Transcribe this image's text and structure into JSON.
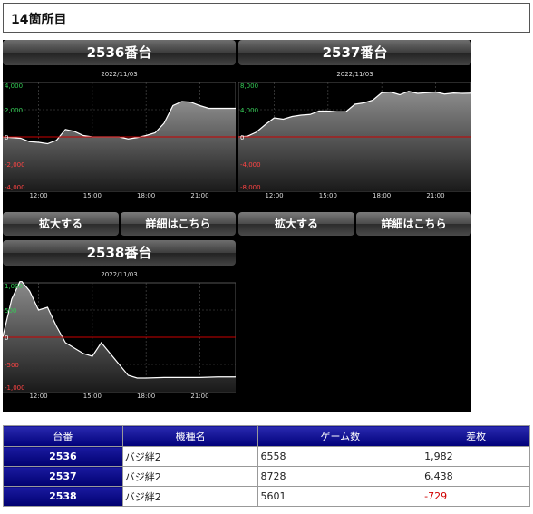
{
  "page_title": "14箇所目",
  "units": [
    {
      "id": "2536",
      "label": "2536番台",
      "date": "2022/11/03",
      "zoom_label": "拡大する",
      "detail_label": "詳細はこちら",
      "chart_data": {
        "type": "area",
        "x_label_ticks": [
          "12:00",
          "15:00",
          "18:00",
          "21:00"
        ],
        "x_range_hours": [
          10,
          23
        ],
        "ylim": [
          -4000,
          4000
        ],
        "y_ticks": [
          4000,
          2000,
          0,
          -2000,
          -4000
        ],
        "y_tick_labels": [
          "4,000",
          "2,000",
          "0",
          "-2,000",
          "-4,000"
        ],
        "points": [
          [
            10,
            0
          ],
          [
            10.5,
            -50
          ],
          [
            11,
            -100
          ],
          [
            11.5,
            -350
          ],
          [
            12,
            -400
          ],
          [
            12.5,
            -500
          ],
          [
            13,
            -250
          ],
          [
            13.5,
            550
          ],
          [
            14,
            400
          ],
          [
            14.5,
            100
          ],
          [
            15,
            0
          ],
          [
            15.5,
            0
          ],
          [
            16,
            0
          ],
          [
            16.5,
            0
          ],
          [
            17,
            -150
          ],
          [
            17.5,
            -50
          ],
          [
            18,
            100
          ],
          [
            18.5,
            300
          ],
          [
            19,
            1000
          ],
          [
            19.5,
            2300
          ],
          [
            20,
            2600
          ],
          [
            20.5,
            2550
          ],
          [
            21,
            2300
          ],
          [
            21.5,
            2100
          ],
          [
            22,
            2100
          ],
          [
            22.5,
            2100
          ],
          [
            23,
            2100
          ]
        ]
      }
    },
    {
      "id": "2537",
      "label": "2537番台",
      "date": "2022/11/03",
      "zoom_label": "拡大する",
      "detail_label": "詳細はこちら",
      "chart_data": {
        "type": "area",
        "x_label_ticks": [
          "12:00",
          "15:00",
          "18:00",
          "21:00"
        ],
        "x_range_hours": [
          10,
          23
        ],
        "ylim": [
          -8000,
          8000
        ],
        "y_ticks": [
          8000,
          4000,
          0,
          -4000,
          -8000
        ],
        "y_tick_labels": [
          "8,000",
          "4,000",
          "0",
          "-4,000",
          "-8,000"
        ],
        "points": [
          [
            10,
            0
          ],
          [
            10.5,
            100
          ],
          [
            11,
            700
          ],
          [
            11.5,
            1800
          ],
          [
            12,
            2800
          ],
          [
            12.5,
            2600
          ],
          [
            13,
            3000
          ],
          [
            13.5,
            3200
          ],
          [
            14,
            3300
          ],
          [
            14.5,
            3800
          ],
          [
            15,
            3800
          ],
          [
            15.5,
            3700
          ],
          [
            16,
            3700
          ],
          [
            16.5,
            4800
          ],
          [
            17,
            5000
          ],
          [
            17.5,
            5400
          ],
          [
            18,
            6500
          ],
          [
            18.5,
            6600
          ],
          [
            19,
            6200
          ],
          [
            19.5,
            6700
          ],
          [
            20,
            6400
          ],
          [
            20.5,
            6500
          ],
          [
            21,
            6600
          ],
          [
            21.5,
            6300
          ],
          [
            22,
            6450
          ],
          [
            22.5,
            6400
          ],
          [
            23,
            6438
          ]
        ]
      }
    },
    {
      "id": "2538",
      "label": "2538番台",
      "date": "2022/11/03",
      "zoom_label": "",
      "detail_label": "",
      "chart_data": {
        "type": "area",
        "x_label_ticks": [
          "12:00",
          "15:00",
          "18:00",
          "21:00"
        ],
        "x_range_hours": [
          10,
          23
        ],
        "ylim": [
          -1000,
          1000
        ],
        "y_ticks": [
          1000,
          500,
          0,
          -500,
          -1000
        ],
        "y_tick_labels": [
          "1,000",
          "500",
          "0",
          "-500",
          "-1,000"
        ],
        "points": [
          [
            10,
            0
          ],
          [
            10.5,
            700
          ],
          [
            11,
            1050
          ],
          [
            11.5,
            850
          ],
          [
            12,
            500
          ],
          [
            12.5,
            550
          ],
          [
            13,
            200
          ],
          [
            13.5,
            -100
          ],
          [
            14,
            -200
          ],
          [
            14.5,
            -300
          ],
          [
            15,
            -350
          ],
          [
            15.5,
            -100
          ],
          [
            16,
            -300
          ],
          [
            16.5,
            -500
          ],
          [
            17,
            -700
          ],
          [
            17.5,
            -750
          ],
          [
            18,
            -750
          ],
          [
            19,
            -740
          ],
          [
            20,
            -740
          ],
          [
            21,
            -740
          ],
          [
            22,
            -729
          ],
          [
            23,
            -729
          ]
        ]
      }
    }
  ],
  "table": {
    "headers": [
      "台番",
      "機種名",
      "ゲーム数",
      "差枚"
    ],
    "rows": [
      {
        "no": "2536",
        "model": "バジ絆2",
        "games": "6558",
        "diff": "1,982",
        "negative": false
      },
      {
        "no": "2537",
        "model": "バジ絆2",
        "games": "8728",
        "diff": "6,438",
        "negative": false
      },
      {
        "no": "2538",
        "model": "バジ絆2",
        "games": "5601",
        "diff": "-729",
        "negative": true
      }
    ]
  },
  "colors": {
    "positive_tick": "#33cc55",
    "negative_tick": "#ff4444",
    "zero_line": "#cc0000",
    "series_line": "#ffffff",
    "table_header": "#000080",
    "negative_value": "#d00000"
  }
}
